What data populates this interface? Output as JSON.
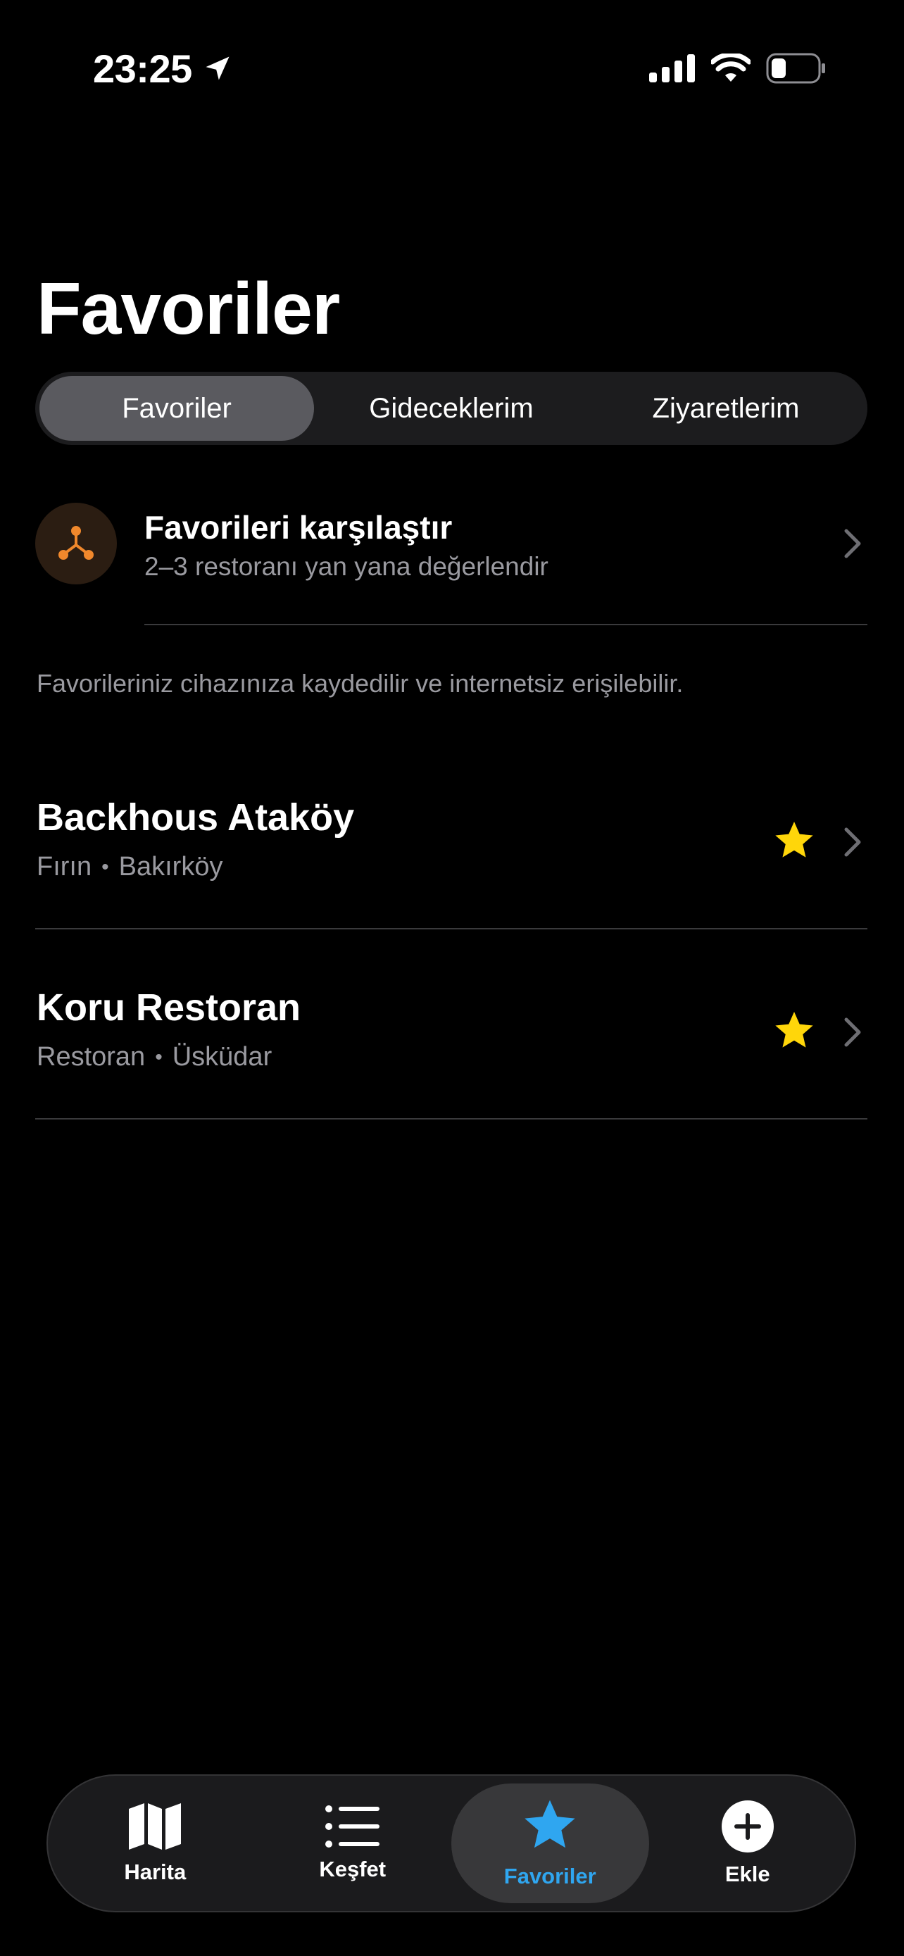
{
  "status_bar": {
    "time": "23:25"
  },
  "header": {
    "title": "Favoriler"
  },
  "segments": [
    {
      "label": "Favoriler",
      "active": true
    },
    {
      "label": "Gideceklerim",
      "active": false
    },
    {
      "label": "Ziyaretlerim",
      "active": false
    }
  ],
  "compare": {
    "title": "Favorileri karşılaştır",
    "subtitle": "2–3 restoranı yan yana değerlendir"
  },
  "info_text": "Favorileriniz cihazınıza kaydedilir ve internetsiz erişilebilir.",
  "favorites": [
    {
      "name": "Backhous Ataköy",
      "category": "Fırın",
      "district": "Bakırköy"
    },
    {
      "name": "Koru Restoran",
      "category": "Restoran",
      "district": "Üsküdar"
    }
  ],
  "tabbar": {
    "tabs": [
      {
        "label": "Harita",
        "icon": "map-icon"
      },
      {
        "label": "Keşfet",
        "icon": "list-icon"
      },
      {
        "label": "Favoriler",
        "icon": "star-icon",
        "active": true
      },
      {
        "label": "Ekle",
        "icon": "plus-circle-icon"
      }
    ]
  },
  "colors": {
    "accent": "#2fa6f0",
    "star": "#ffd60a",
    "compare_icon": "#f0882c"
  }
}
